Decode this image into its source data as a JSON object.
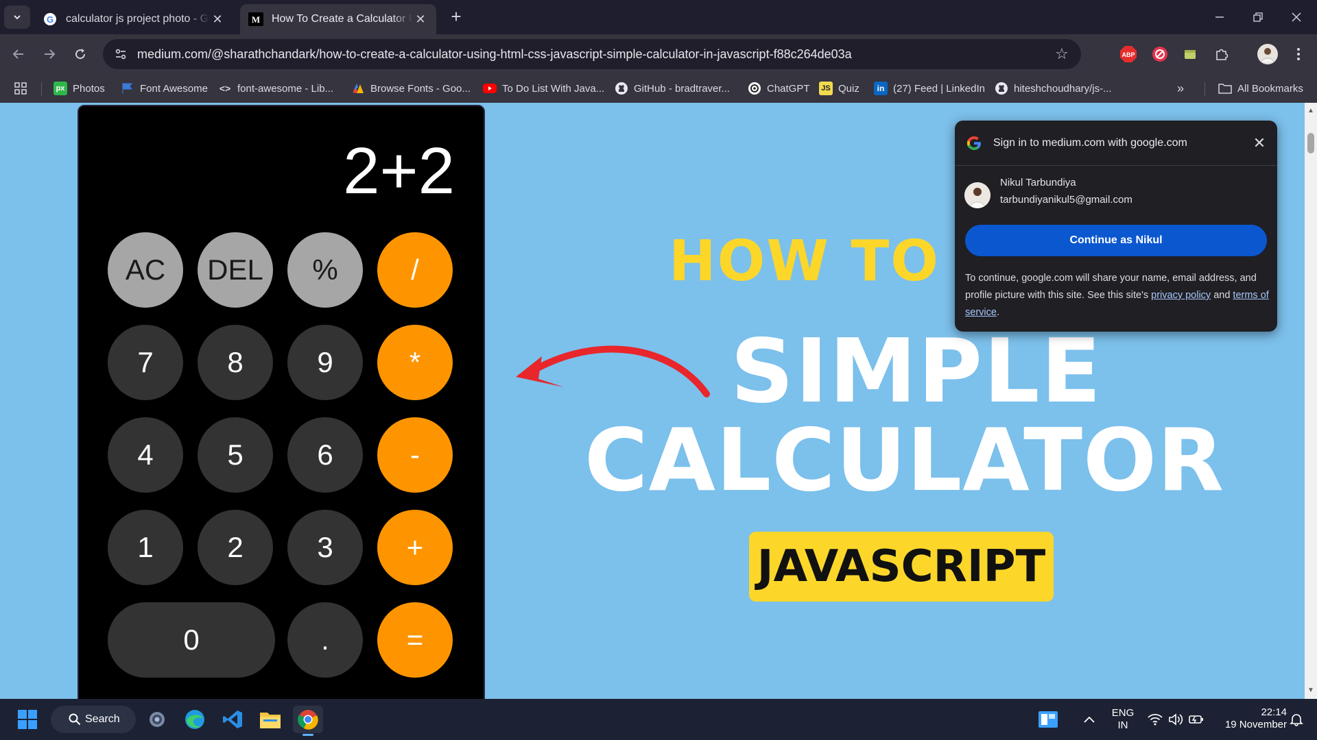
{
  "tabs": [
    {
      "title": "calculator js project photo - Go",
      "favicon": "google-icon",
      "active": false
    },
    {
      "title": "How To Create a Calculator Usin",
      "favicon": "medium-icon",
      "active": true
    }
  ],
  "toolbar": {
    "url": "medium.com/@sharathchandark/how-to-create-a-calculator-using-html-css-javascript-simple-calculator-in-javascript-f88c264de03a",
    "extensions": [
      "abp-icon",
      "blocker-icon",
      "extension-icon",
      "puzzle-icon"
    ]
  },
  "bookmarks": [
    {
      "label": "Photos",
      "icon": "px-icon"
    },
    {
      "label": "Font Awesome",
      "icon": "flag-icon"
    },
    {
      "label": "font-awesome - Lib...",
      "icon": "code-icon"
    },
    {
      "label": "Browse Fonts - Goo...",
      "icon": "fonts-icon"
    },
    {
      "label": "To Do List With Java...",
      "icon": "youtube-icon"
    },
    {
      "label": "GitHub - bradtraver...",
      "icon": "github-icon"
    },
    {
      "label": "ChatGPT",
      "icon": "chatgpt-icon"
    },
    {
      "label": "Quiz",
      "icon": "js-icon"
    },
    {
      "label": "(27) Feed | LinkedIn",
      "icon": "linkedin-icon"
    },
    {
      "label": "hiteshchoudhary/js-...",
      "icon": "github-icon"
    }
  ],
  "bookmarks_all": "All Bookmarks",
  "calculator": {
    "display": "2+2",
    "keys": [
      [
        "AC",
        "DEL",
        "%",
        "/"
      ],
      [
        "7",
        "8",
        "9",
        "*"
      ],
      [
        "4",
        "5",
        "6",
        "-"
      ],
      [
        "1",
        "2",
        "3",
        "+"
      ],
      [
        "0",
        ".",
        "="
      ]
    ]
  },
  "hero": {
    "line1": "HOW TO C",
    "line2": "SIMPLE",
    "line3": "CALCULATOR",
    "badge": "JAVASCRIPT"
  },
  "signin_popup": {
    "title": "Sign in to medium.com with google.com",
    "name": "Nikul Tarbundiya",
    "email": "tarbundiyanikul5@gmail.com",
    "continue_label": "Continue as Nikul",
    "desc_pre": "To continue, google.com will share your name, email address, and profile picture with this site. See this site's ",
    "privacy_link": "privacy policy",
    "desc_mid": " and ",
    "terms_link": "terms of service",
    "desc_post": "."
  },
  "taskbar": {
    "search_label": "Search",
    "lang_line1": "ENG",
    "lang_line2": "IN",
    "time": "22:14",
    "date": "19 November"
  },
  "colors": {
    "page_bg": "#7cc0ec",
    "orange_key": "#fe9500",
    "headline_yellow": "#fcd72a",
    "google_button": "#0b57d0"
  }
}
